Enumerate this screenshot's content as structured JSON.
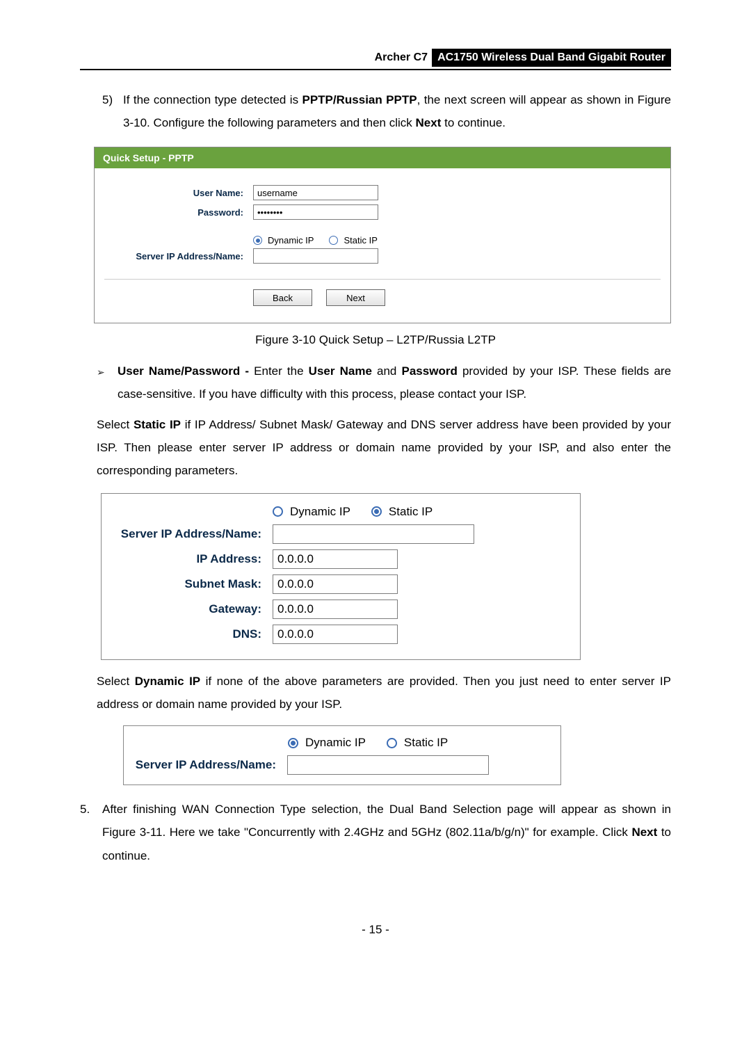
{
  "header": {
    "left": "Archer C7",
    "right": "AC1750 Wireless Dual Band Gigabit Router"
  },
  "step5": {
    "num": "5)",
    "t1": "If the connection type detected is ",
    "b1": "PPTP/Russian PPTP",
    "t2": ", the next screen will appear as shown in Figure 3-10. Configure the following parameters and then click ",
    "b2": "Next",
    "t3": " to continue."
  },
  "figurePptp": {
    "title": "Quick Setup - PPTP",
    "userNameLabel": "User Name:",
    "userNameValue": "username",
    "passwordLabel": "Password:",
    "passwordValue": "••••••••",
    "dynamicLabel": "Dynamic IP",
    "staticLabel": "Static IP",
    "serverLabel": "Server IP Address/Name:",
    "backBtn": "Back",
    "nextBtn": "Next"
  },
  "caption1": "Figure 3-10 Quick Setup – L2TP/Russia L2TP",
  "bullet1": {
    "b1": "User Name/Password - ",
    "t1": "Enter the ",
    "b2": "User Name",
    "t2": " and ",
    "b3": "Password",
    "t3": " provided by your ISP. These fields are case-sensitive. If you have difficulty with this process, please contact your ISP."
  },
  "paraStatic": {
    "t1": "Select ",
    "b1": "Static IP",
    "t2": " if IP Address/ Subnet Mask/ Gateway and DNS server address have been provided by your ISP. Then please enter server IP address or domain name provided by your ISP, and also enter the corresponding parameters."
  },
  "figureStatic": {
    "dynamicLabel": "Dynamic IP",
    "staticLabel": "Static IP",
    "serverLabel": "Server IP Address/Name:",
    "ipLabel": "IP Address:",
    "ipValue": "0.0.0.0",
    "maskLabel": "Subnet Mask:",
    "maskValue": "0.0.0.0",
    "gwLabel": "Gateway:",
    "gwValue": "0.0.0.0",
    "dnsLabel": "DNS:",
    "dnsValue": "0.0.0.0"
  },
  "paraDynamic": {
    "t1": "Select ",
    "b1": "Dynamic IP",
    "t2": " if none of the above parameters are provided. Then you just need to enter server IP address or domain name provided by your ISP."
  },
  "figureDyn": {
    "dynamicLabel": "Dynamic IP",
    "staticLabel": "Static IP",
    "serverLabel": "Server IP Address/Name:"
  },
  "mainStep5": {
    "num": "5.",
    "t1": "After finishing WAN Connection Type selection, the Dual Band Selection page will appear as shown in Figure 3-11. Here we take \"Concurrently with 2.4GHz and 5GHz (802.11a/b/g/n)\" for example. Click ",
    "b1": "Next",
    "t2": " to continue."
  },
  "pageNum": "- 15 -"
}
